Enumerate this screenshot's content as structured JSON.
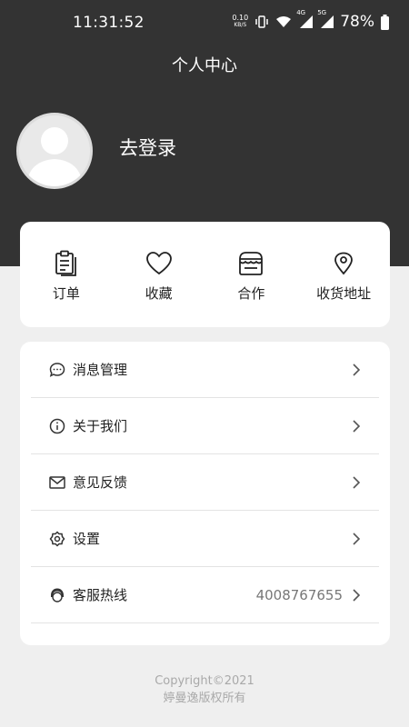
{
  "status_bar": {
    "time": "11:31:52",
    "net_speed": "0.10",
    "net_unit": "KB/S",
    "signal_4g": "4G",
    "signal_5g": "5G",
    "battery": "78%"
  },
  "header": {
    "title": "个人中心",
    "login_label": "去登录"
  },
  "quick_actions": [
    {
      "label": "订单",
      "icon": "clipboard-icon"
    },
    {
      "label": "收藏",
      "icon": "heart-icon"
    },
    {
      "label": "合作",
      "icon": "store-icon"
    },
    {
      "label": "收货地址",
      "icon": "location-pin-icon"
    }
  ],
  "menu": [
    {
      "label": "消息管理",
      "icon": "chat-bubble-icon",
      "value": ""
    },
    {
      "label": "关于我们",
      "icon": "info-icon",
      "value": ""
    },
    {
      "label": "意见反馈",
      "icon": "mail-icon",
      "value": ""
    },
    {
      "label": "设置",
      "icon": "gear-icon",
      "value": ""
    },
    {
      "label": "客服热线",
      "icon": "headset-icon",
      "value": "4008767655"
    }
  ],
  "footer": {
    "copyright": "Copyright©2021",
    "rights": "婷曼逸版权所有"
  }
}
